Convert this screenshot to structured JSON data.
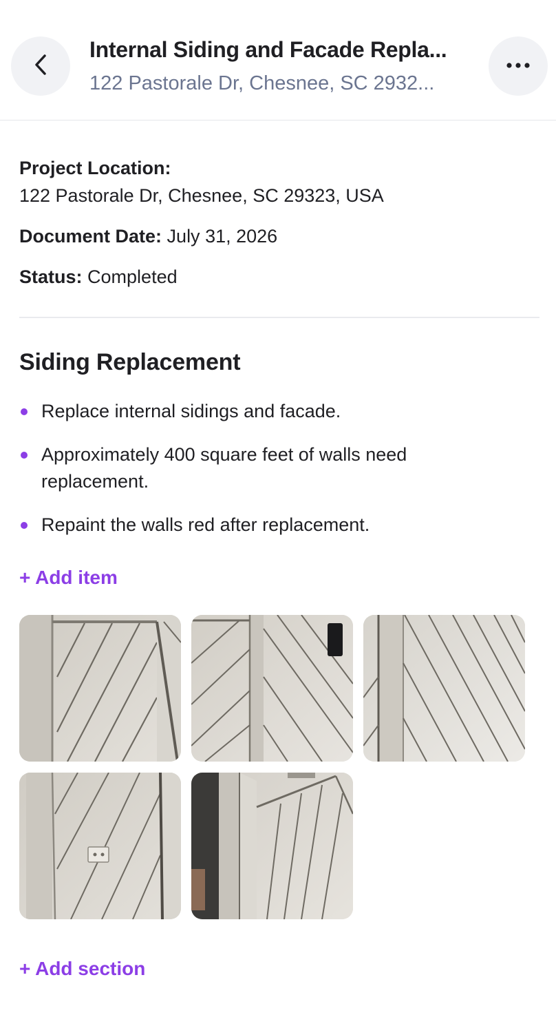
{
  "header": {
    "title": "Internal Siding and Facade Repla...",
    "subtitle": "122 Pastorale Dr, Chesnee, SC 2932..."
  },
  "meta": {
    "location_label": "Project Location:",
    "location_value": "122 Pastorale Dr, Chesnee, SC 29323, USA",
    "date_label": "Document Date:",
    "date_value": "July 31, 2026",
    "status_label": "Status:",
    "status_value": "Completed"
  },
  "section": {
    "title": "Siding Replacement",
    "items": [
      "Replace internal sidings and facade.",
      "Approximately 400 square feet of walls need replacement.",
      "Repaint the walls red after replacement."
    ],
    "add_item_label": "+ Add item",
    "photo_count": 5
  },
  "add_section_label": "+ Add section",
  "colors": {
    "accent": "#8c3ee6",
    "subtitle": "#6b7590",
    "button_bg": "#f1f2f5"
  },
  "icons": {
    "back": "chevron-left-icon",
    "more": "more-horizontal-icon",
    "bullet": "bullet-dot-icon"
  }
}
